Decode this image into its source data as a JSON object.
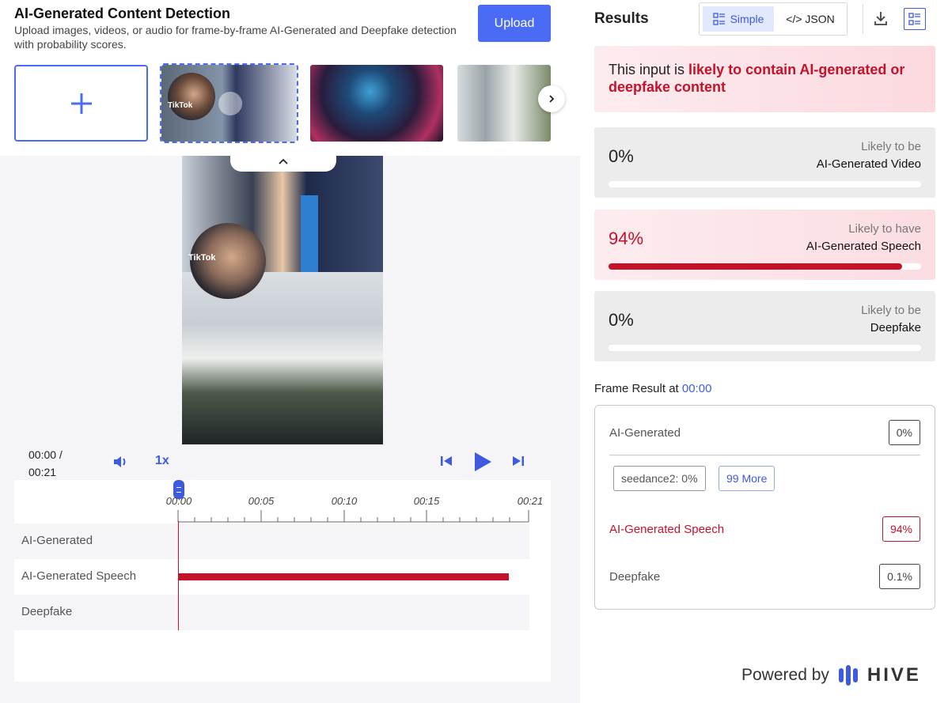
{
  "header": {
    "title": "AI-Generated Content Detection",
    "description": "Upload images, videos, or audio for frame-by-frame AI-Generated and Deepfake detection with probability scores.",
    "upload_label": "Upload"
  },
  "thumbnails": {
    "t1_overlay": "TikTok"
  },
  "player": {
    "time_current": "00:00 /",
    "time_total": "00:21",
    "speed": "1x",
    "ticks": [
      "00:00",
      "00:05",
      "00:10",
      "00:15",
      "00:21"
    ],
    "tracks": [
      {
        "label": "AI-Generated"
      },
      {
        "label": "AI-Generated Speech"
      },
      {
        "label": "Deepfake"
      }
    ]
  },
  "video": {
    "overlay_text": "TikTok"
  },
  "results": {
    "title": "Results",
    "toggle_simple": "Simple",
    "toggle_json": "</> JSON",
    "alert_prefix": "This input is ",
    "alert_highlight": "likely to contain AI-generated or deepfake content",
    "cards": [
      {
        "pct": "0%",
        "cap1": "Likely to be",
        "cap2": "AI-Generated Video",
        "fill": 0
      },
      {
        "pct": "94%",
        "cap1": "Likely to have",
        "cap2": "AI-Generated Speech",
        "fill": 0.94
      },
      {
        "pct": "0%",
        "cap1": "Likely to be",
        "cap2": "Deepfake",
        "fill": 0
      }
    ],
    "frame_title_prefix": "Frame Result at ",
    "frame_time": "00:00",
    "frame": {
      "ai_generated_label": "AI-Generated",
      "ai_generated_value": "0%",
      "chip_model": "seedance2: 0%",
      "chip_more": "99 More",
      "speech_label": "AI-Generated Speech",
      "speech_value": "94%",
      "deepfake_label": "Deepfake",
      "deepfake_value": "0.1%"
    },
    "powered_by": "Powered by",
    "brand": "HIVE"
  },
  "colors": {
    "accent": "#4a6cf5",
    "alert_red": "#c3122a"
  }
}
